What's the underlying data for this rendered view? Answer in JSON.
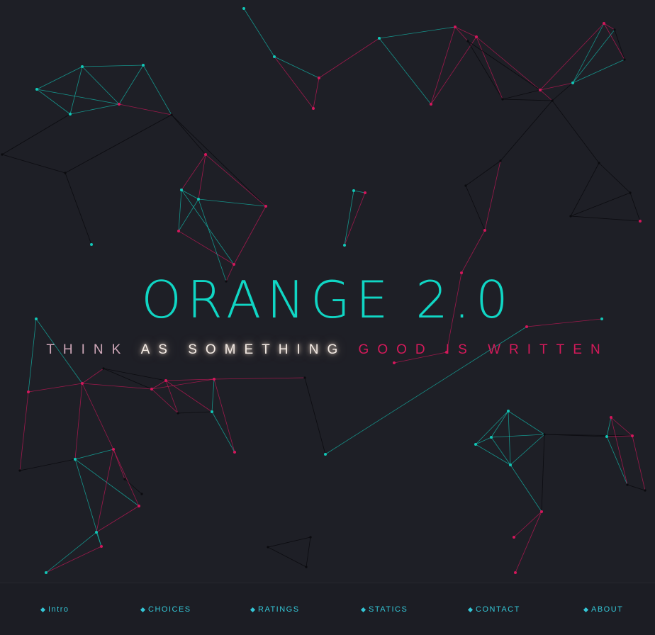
{
  "hero": {
    "title": "ORANGE 2.0",
    "tagline_words": [
      "THINK",
      "AS",
      "SOMETHING",
      "GOOD",
      "IS",
      "WRITTEN"
    ]
  },
  "nav": {
    "items": [
      {
        "label": "Intro"
      },
      {
        "label": "CHOICES"
      },
      {
        "label": "RATINGS"
      },
      {
        "label": "STATICS"
      },
      {
        "label": "CONTACT"
      },
      {
        "label": "ABOUT"
      }
    ]
  },
  "colors": {
    "background": "#1e1f26",
    "accent_cyan": "#10d6c4",
    "accent_pink": "#d41a5a",
    "nav_text": "#34c6d6",
    "glow_text": "#f4ebe5"
  }
}
